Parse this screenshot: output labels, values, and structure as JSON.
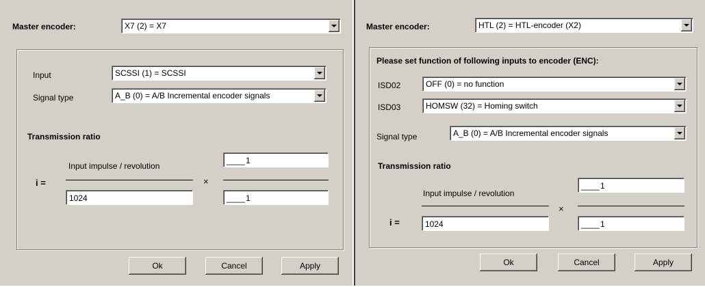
{
  "left": {
    "master_label": "Master encoder:",
    "master_value": "X7 (2) = X7",
    "input_label": "Input",
    "input_value": "SCSSI (1) = SCSSI",
    "signal_label": "Signal type",
    "signal_value": "A_B (0) = A/B Incremental encoder signals",
    "ratio_title": "Transmission ratio",
    "i_label": "i =",
    "impulse_label": "Input impulse / revolution",
    "impulse_value": "1024",
    "times": "×",
    "num_value": "1",
    "den_value": "1",
    "ok": "Ok",
    "cancel": "Cancel",
    "apply": "Apply"
  },
  "right": {
    "master_label": "Master encoder:",
    "master_value": "HTL (2) = HTL-encoder (X2)",
    "set_function": "Please set function of following inputs to encoder (ENC):",
    "isd02_label": "ISD02",
    "isd02_value": "OFF (0) = no function",
    "isd03_label": "ISD03",
    "isd03_value": "HOMSW (32) = Homing switch",
    "signal_label": "Signal type",
    "signal_value": "A_B (0) = A/B Incremental encoder signals",
    "ratio_title": "Transmission ratio",
    "i_label": "i =",
    "impulse_label": "Input impulse / revolution",
    "impulse_value": "1024",
    "times": "×",
    "num_value": "1",
    "den_value": "1",
    "ok": "Ok",
    "cancel": "Cancel",
    "apply": "Apply"
  }
}
